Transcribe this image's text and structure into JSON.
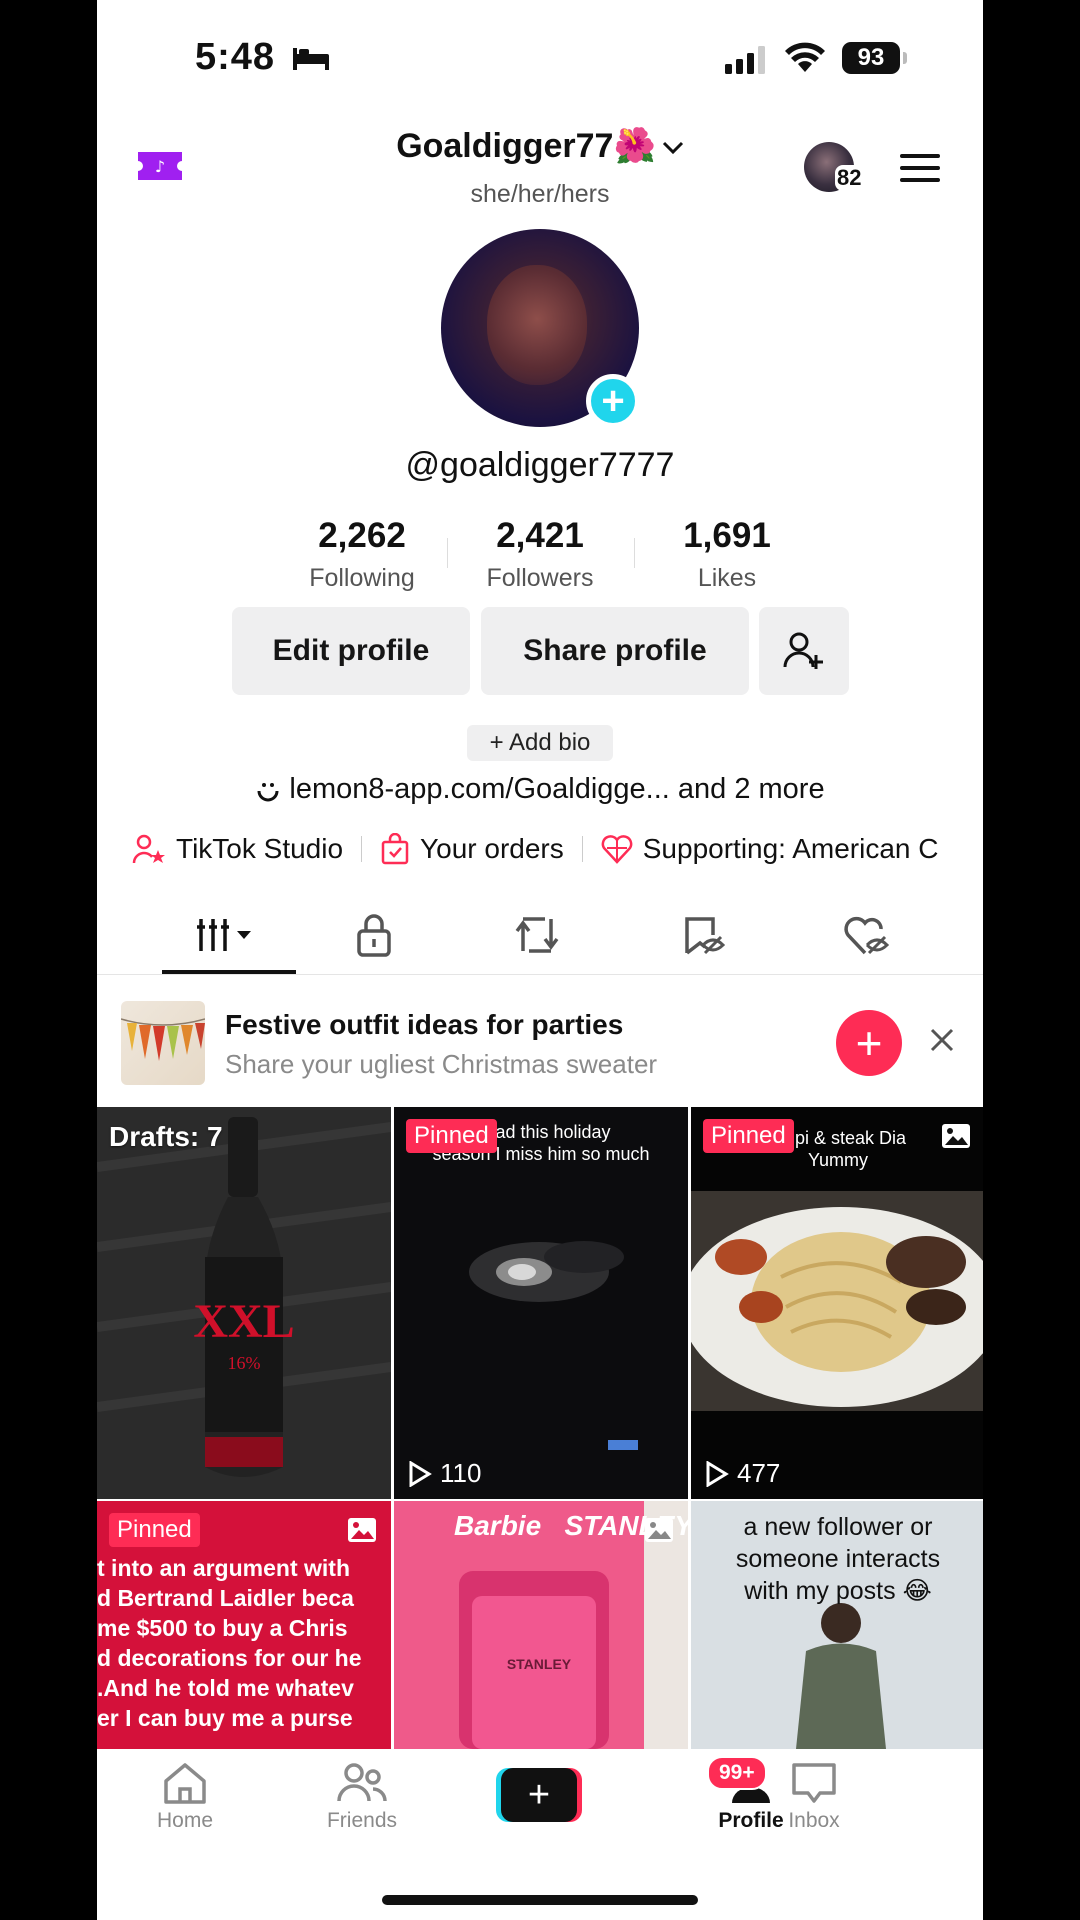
{
  "status_bar": {
    "time": "5:48",
    "battery": "93"
  },
  "header": {
    "username": "Goaldigger77🌺",
    "pronouns": "she/her/hers",
    "notification_count": "82"
  },
  "profile": {
    "handle": "@goaldigger7777"
  },
  "stats": [
    {
      "value": "2,262",
      "label": "Following"
    },
    {
      "value": "2,421",
      "label": "Followers"
    },
    {
      "value": "1,691",
      "label": "Likes"
    }
  ],
  "actions": {
    "edit_profile": "Edit profile",
    "share_profile": "Share profile"
  },
  "bio": {
    "add_bio": "+ Add bio",
    "link": "lemon8-app.com/Goaldigge... and 2 more"
  },
  "shortcuts": [
    {
      "label": "TikTok Studio"
    },
    {
      "label": "Your orders"
    },
    {
      "label": "Supporting: American C"
    }
  ],
  "banner": {
    "title": "Festive outfit ideas for parties",
    "subtitle": "Share your ugliest Christmas sweater"
  },
  "grid": {
    "drafts": "Drafts: 7",
    "pinned": "Pinned",
    "cells": [
      {
        "caption": "y dad this holiday\nseason I miss him so much",
        "views": "110"
      },
      {
        "caption": "ampi & steak Dia\nYummy",
        "views": "477"
      },
      {
        "caption": "t into an argument with\nd Bertrand Laidler beca\nme $500 to buy a Chris\nd decorations for our he\n.And he told me whatev\ner I can buy me a purse"
      },
      {
        "caption": "Barbie   STANLEY"
      },
      {
        "caption": "a new follower or\nsomeone interacts\nwith my posts 😂"
      }
    ]
  },
  "bottom_nav": {
    "home": "Home",
    "friends": "Friends",
    "inbox": "Inbox",
    "inbox_badge": "99+",
    "profile": "Profile"
  },
  "colors": {
    "accent": "#fe2c55",
    "cyan": "#20d5ec",
    "ticket": "#a020f0"
  }
}
